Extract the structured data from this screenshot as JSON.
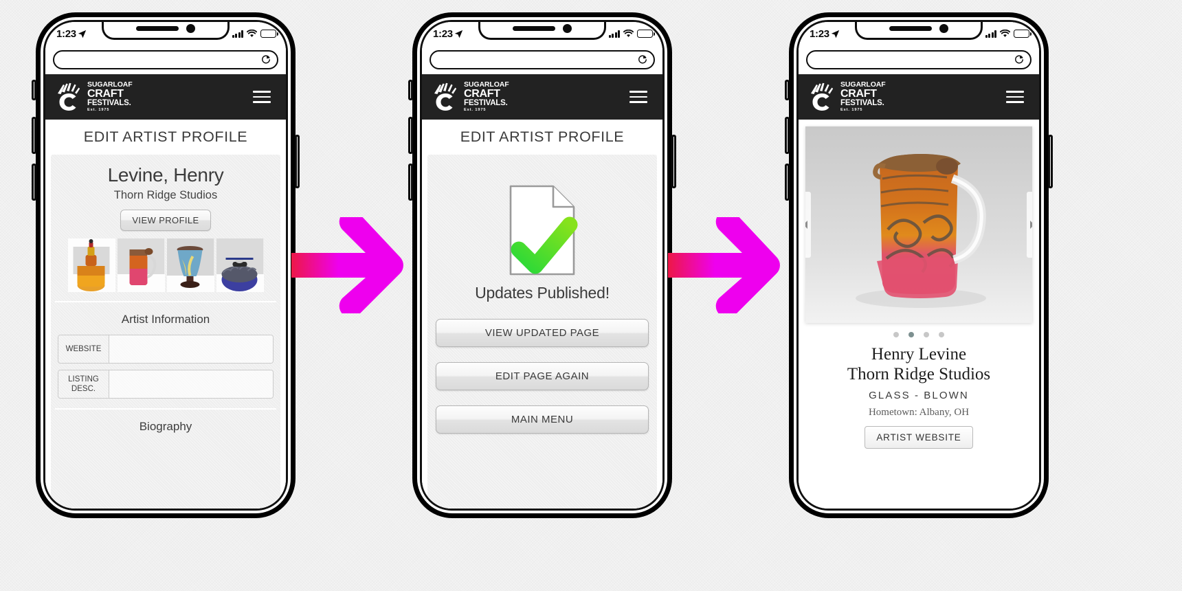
{
  "phones": [
    {
      "id": "phone-edit-profile",
      "status": {
        "time": "1:23",
        "location_icon": "location-arrow-icon",
        "signal_icon": "signal-bars-icon",
        "wifi_icon": "wifi-icon",
        "battery_icon": "battery-icon"
      },
      "browser": {
        "url": "",
        "placeholder": "",
        "reload_icon": "reload-icon"
      },
      "header": {
        "logo_icon": "sugarloaf-hand-logo-icon",
        "brand_line1": "SUGARLOAF",
        "brand_line2": "CRAFT",
        "brand_line3": "FESTIVALS.",
        "brand_line4": "Est. 1975",
        "menu_icon": "hamburger-menu-icon"
      },
      "page_title": "EDIT ARTIST PROFILE",
      "artist_name": "Levine, Henry",
      "studio_name": "Thorn Ridge Studios",
      "view_profile_label": "VIEW PROFILE",
      "thumbnails": [
        {
          "name": "amber-glass-jar",
          "alt": "Amber glass lidded jar"
        },
        {
          "name": "orange-pink-glass-pitcher",
          "alt": "Orange and pink glass pitcher"
        },
        {
          "name": "blue-glass-goblet",
          "alt": "Blue glass goblet"
        },
        {
          "name": "blue-glass-covered-vessel",
          "alt": "Blue glass covered vessel"
        }
      ],
      "section_heading": "Artist Information",
      "fields": [
        {
          "label": "WEBSITE",
          "value": "",
          "placeholder": ""
        },
        {
          "label": "LISTING DESC.",
          "value": "",
          "placeholder": ""
        }
      ],
      "biography_heading": "Biography"
    },
    {
      "id": "phone-updates-published",
      "status": {
        "time": "1:23",
        "location_icon": "location-arrow-icon",
        "signal_icon": "signal-bars-icon",
        "wifi_icon": "wifi-icon",
        "battery_icon": "battery-icon"
      },
      "browser": {
        "url": "",
        "placeholder": "",
        "reload_icon": "reload-icon"
      },
      "header": {
        "logo_icon": "sugarloaf-hand-logo-icon",
        "brand_line1": "SUGARLOAF",
        "brand_line2": "CRAFT",
        "brand_line3": "FESTIVALS.",
        "brand_line4": "Est. 1975",
        "menu_icon": "hamburger-menu-icon"
      },
      "page_title": "EDIT ARTIST PROFILE",
      "success_icon": "document-check-icon",
      "success_message": "Updates Published!",
      "buttons": [
        {
          "label": "VIEW UPDATED PAGE",
          "name": "view-updated-page-button"
        },
        {
          "label": "EDIT PAGE AGAIN",
          "name": "edit-page-again-button"
        },
        {
          "label": "MAIN MENU",
          "name": "main-menu-button"
        }
      ]
    },
    {
      "id": "phone-public-profile",
      "status": {
        "time": "1:23",
        "location_icon": "location-arrow-icon",
        "signal_icon": "signal-bars-icon",
        "wifi_icon": "wifi-icon",
        "battery_icon": "battery-icon"
      },
      "browser": {
        "url": "",
        "placeholder": "",
        "reload_icon": "reload-icon"
      },
      "header": {
        "logo_icon": "sugarloaf-hand-logo-icon",
        "brand_line1": "SUGARLOAF",
        "brand_line2": "CRAFT",
        "brand_line3": "FESTIVALS.",
        "brand_line4": "Est. 1975",
        "menu_icon": "hamburger-menu-icon"
      },
      "carousel": {
        "image_name": "orange-pink-glass-pitcher-large",
        "prev_icon": "chevron-left-icon",
        "next_icon": "chevron-right-icon",
        "dot_count": 4,
        "active_dot": 2
      },
      "artist_name": "Henry Levine",
      "studio_name": "Thorn Ridge Studios",
      "medium": "GLASS  -  BLOWN",
      "hometown": "Hometown: Albany, OH",
      "website_button_label": "ARTIST WEBSITE"
    }
  ],
  "flow_arrows": [
    {
      "name": "flow-arrow-1",
      "direction": "right"
    },
    {
      "name": "flow-arrow-2",
      "direction": "right"
    }
  ],
  "colors": {
    "header_bg": "#222222",
    "arrow_start": "#ED1847",
    "arrow_end": "#EE00EE",
    "check_green": "#2BD938",
    "check_green_light": "#86E21C",
    "panel_bg": "#EEEEEE",
    "dot_active": "#7D9090",
    "dot_inactive": "#C7C7C7"
  }
}
